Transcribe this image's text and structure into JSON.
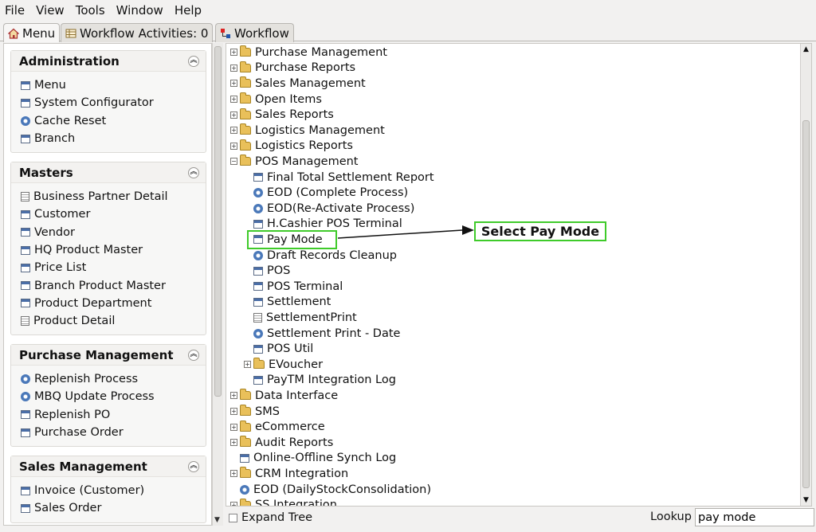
{
  "menubar": [
    "File",
    "View",
    "Tools",
    "Window",
    "Help"
  ],
  "tabs": [
    {
      "label": "Menu",
      "icon": "home-icon"
    },
    {
      "label": "Workflow Activities: 0",
      "icon": "table-icon"
    },
    {
      "label": "Workflow",
      "icon": "workflow-icon"
    }
  ],
  "groups": [
    {
      "title": "Administration",
      "items": [
        {
          "label": "Menu",
          "icon": "window-icon"
        },
        {
          "label": "System Configurator",
          "icon": "window-icon"
        },
        {
          "label": "Cache Reset",
          "icon": "gear-icon"
        },
        {
          "label": "Branch",
          "icon": "window-icon"
        }
      ]
    },
    {
      "title": "Masters",
      "items": [
        {
          "label": "Business Partner Detail",
          "icon": "document-icon"
        },
        {
          "label": "Customer",
          "icon": "window-icon"
        },
        {
          "label": "Vendor",
          "icon": "window-icon"
        },
        {
          "label": "HQ Product Master",
          "icon": "window-icon"
        },
        {
          "label": "Price List",
          "icon": "window-icon"
        },
        {
          "label": "Branch Product Master",
          "icon": "window-icon"
        },
        {
          "label": "Product Department",
          "icon": "window-icon"
        },
        {
          "label": "Product Detail",
          "icon": "document-icon"
        }
      ]
    },
    {
      "title": "Purchase Management",
      "items": [
        {
          "label": "Replenish Process",
          "icon": "gear-icon"
        },
        {
          "label": "MBQ Update Process",
          "icon": "gear-icon"
        },
        {
          "label": "Replenish PO",
          "icon": "window-icon"
        },
        {
          "label": "Purchase Order",
          "icon": "window-icon"
        }
      ]
    },
    {
      "title": "Sales Management",
      "items": [
        {
          "label": "Invoice (Customer)",
          "icon": "window-icon"
        },
        {
          "label": "Sales Order",
          "icon": "window-icon"
        }
      ]
    }
  ],
  "tree": [
    {
      "label": "Purchase Management",
      "type": "folder",
      "level": 0,
      "expander": "+"
    },
    {
      "label": "Purchase Reports",
      "type": "folder",
      "level": 0,
      "expander": "+"
    },
    {
      "label": "Sales Management",
      "type": "folder",
      "level": 0,
      "expander": "+"
    },
    {
      "label": "Open Items",
      "type": "folder",
      "level": 0,
      "expander": "+"
    },
    {
      "label": "Sales Reports",
      "type": "folder",
      "level": 0,
      "expander": "+"
    },
    {
      "label": "Logistics Management",
      "type": "folder",
      "level": 0,
      "expander": "+"
    },
    {
      "label": "Logistics Reports",
      "type": "folder",
      "level": 0,
      "expander": "+"
    },
    {
      "label": "POS Management",
      "type": "folder",
      "level": 0,
      "expander": "-"
    },
    {
      "label": "Final Total Settlement Report",
      "type": "window",
      "level": 1,
      "expander": ""
    },
    {
      "label": "EOD (Complete Process)",
      "type": "gear",
      "level": 1,
      "expander": ""
    },
    {
      "label": "EOD(Re-Activate Process)",
      "type": "gear",
      "level": 1,
      "expander": ""
    },
    {
      "label": "H.Cashier POS Terminal",
      "type": "window",
      "level": 1,
      "expander": ""
    },
    {
      "label": "Pay Mode",
      "type": "window",
      "level": 1,
      "expander": ""
    },
    {
      "label": "Draft Records Cleanup",
      "type": "gear",
      "level": 1,
      "expander": ""
    },
    {
      "label": "POS",
      "type": "window",
      "level": 1,
      "expander": ""
    },
    {
      "label": "POS Terminal",
      "type": "window",
      "level": 1,
      "expander": ""
    },
    {
      "label": "Settlement",
      "type": "window",
      "level": 1,
      "expander": ""
    },
    {
      "label": "SettlementPrint",
      "type": "document",
      "level": 1,
      "expander": ""
    },
    {
      "label": "Settlement Print - Date",
      "type": "gear",
      "level": 1,
      "expander": ""
    },
    {
      "label": "POS Util",
      "type": "window",
      "level": 1,
      "expander": ""
    },
    {
      "label": "EVoucher",
      "type": "folder",
      "level": 1,
      "expander": "+"
    },
    {
      "label": "PayTM Integration Log",
      "type": "window",
      "level": 1,
      "expander": ""
    },
    {
      "label": "Data Interface",
      "type": "folder",
      "level": 0,
      "expander": "+"
    },
    {
      "label": "SMS",
      "type": "folder",
      "level": 0,
      "expander": "+"
    },
    {
      "label": "eCommerce",
      "type": "folder",
      "level": 0,
      "expander": "+"
    },
    {
      "label": "Audit Reports",
      "type": "folder",
      "level": 0,
      "expander": "+"
    },
    {
      "label": "Online-Offline Synch Log",
      "type": "window",
      "level": 0,
      "expander": ""
    },
    {
      "label": "CRM Integration",
      "type": "folder",
      "level": 0,
      "expander": "+"
    },
    {
      "label": "EOD (DailyStockConsolidation)",
      "type": "gear",
      "level": 0,
      "expander": ""
    },
    {
      "label": "SS Integration",
      "type": "folder",
      "level": 0,
      "expander": "+"
    }
  ],
  "callout": {
    "text": "Select Pay Mode"
  },
  "bottom": {
    "expand_tree_label": "Expand Tree",
    "lookup_label": "Lookup",
    "lookup_value": "pay mode"
  }
}
